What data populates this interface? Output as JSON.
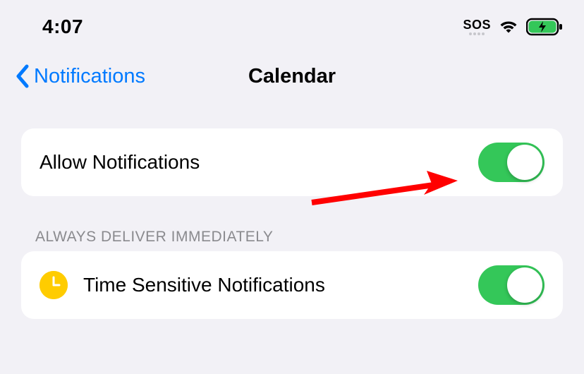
{
  "status_bar": {
    "time": "4:07",
    "sos": "SOS"
  },
  "nav": {
    "back_label": "Notifications",
    "title": "Calendar"
  },
  "settings": {
    "allow_notifications": {
      "label": "Allow Notifications",
      "enabled": true
    }
  },
  "section_header": "ALWAYS DELIVER IMMEDIATELY",
  "time_sensitive": {
    "label": "Time Sensitive Notifications",
    "enabled": true
  },
  "colors": {
    "accent": "#007aff",
    "toggle_on": "#34c759",
    "clock_yellow": "#ffcc00"
  }
}
